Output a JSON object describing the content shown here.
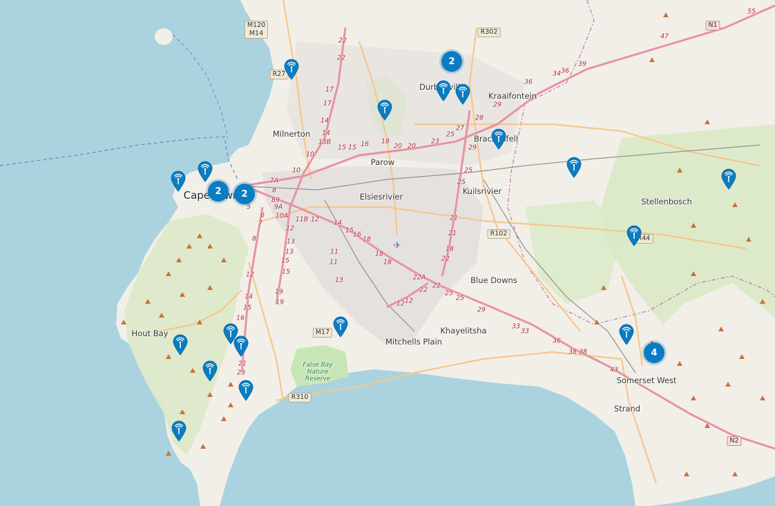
{
  "places": [
    {
      "id": "cape-town",
      "text": "Cape Town",
      "big": true
    },
    {
      "id": "milnerton",
      "text": "Milnerton"
    },
    {
      "id": "parow",
      "text": "Parow"
    },
    {
      "id": "elsiesrivier",
      "text": "Elsiesrivier"
    },
    {
      "id": "kuilsrivier",
      "text": "Kuilsrivier"
    },
    {
      "id": "durbanville",
      "text": "Durbanville"
    },
    {
      "id": "kraaifontein",
      "text": "Kraaifontein"
    },
    {
      "id": "brackenfell",
      "text": "Brackenfell"
    },
    {
      "id": "stellenbosch",
      "text": "Stellenbosch"
    },
    {
      "id": "blue-downs",
      "text": "Blue Downs"
    },
    {
      "id": "khayelitsha",
      "text": "Khayelitsha"
    },
    {
      "id": "mitchells-plain",
      "text": "Mitchells Plain"
    },
    {
      "id": "hout-bay",
      "text": "Hout Bay"
    },
    {
      "id": "somerset-west",
      "text": "Somerset West"
    },
    {
      "id": "strand",
      "text": "Strand"
    },
    {
      "id": "false-bay-reserve",
      "text": "False Bay Nature Reserve",
      "park": true
    }
  ],
  "route_shields": [
    {
      "id": "m120-m14",
      "text": "M120\nM14"
    },
    {
      "id": "r27",
      "text": "R27"
    },
    {
      "id": "r302",
      "text": "R302"
    },
    {
      "id": "n1",
      "text": "N1",
      "national": true
    },
    {
      "id": "r102",
      "text": "R102"
    },
    {
      "id": "r44",
      "text": "R44"
    },
    {
      "id": "m17",
      "text": "M17"
    },
    {
      "id": "r310",
      "text": "R310"
    },
    {
      "id": "n2",
      "text": "N2",
      "national": true
    }
  ],
  "exit_numbers": [
    "55",
    "47",
    "39",
    "36",
    "34",
    "36",
    "29",
    "28",
    "27",
    "25",
    "29",
    "25",
    "25",
    "23",
    "20",
    "20",
    "18",
    "16",
    "15",
    "15",
    "13B",
    "14",
    "14",
    "17",
    "17",
    "22",
    "22",
    "10",
    "10",
    "7A",
    "8",
    "8",
    "9",
    "9A",
    "10A",
    "11B",
    "12",
    "6",
    "7",
    "5",
    "12",
    "13",
    "13",
    "15",
    "15",
    "14",
    "15",
    "16",
    "18",
    "18",
    "18",
    "21",
    "21",
    "18",
    "22A",
    "22",
    "22",
    "22",
    "25",
    "25",
    "29",
    "33",
    "33",
    "36",
    "38",
    "38",
    "43",
    "11",
    "11",
    "13",
    "12",
    "12",
    "14",
    "15",
    "16",
    "19",
    "19",
    "21",
    "23",
    "8",
    "12"
  ],
  "markers": [
    {
      "id": "marker-1",
      "type": "antenna"
    },
    {
      "id": "marker-2",
      "type": "antenna"
    },
    {
      "id": "marker-3",
      "type": "antenna"
    },
    {
      "id": "marker-4",
      "type": "antenna"
    },
    {
      "id": "marker-5",
      "type": "antenna"
    },
    {
      "id": "marker-6",
      "type": "antenna"
    },
    {
      "id": "marker-7",
      "type": "antenna"
    },
    {
      "id": "marker-8",
      "type": "antenna"
    },
    {
      "id": "marker-9",
      "type": "antenna"
    },
    {
      "id": "marker-10",
      "type": "antenna"
    },
    {
      "id": "marker-11",
      "type": "antenna"
    },
    {
      "id": "marker-12",
      "type": "antenna"
    },
    {
      "id": "marker-13",
      "type": "antenna"
    },
    {
      "id": "marker-14",
      "type": "antenna"
    },
    {
      "id": "marker-15",
      "type": "antenna"
    },
    {
      "id": "marker-16",
      "type": "antenna"
    },
    {
      "id": "marker-17",
      "type": "antenna"
    },
    {
      "id": "marker-18",
      "type": "antenna"
    }
  ],
  "clusters": [
    {
      "id": "cluster-durbanville",
      "count": "2"
    },
    {
      "id": "cluster-cape-town-a",
      "count": "2"
    },
    {
      "id": "cluster-cape-town-b",
      "count": "2"
    },
    {
      "id": "cluster-somerset-west",
      "count": "4"
    }
  ],
  "colors": {
    "water": "#aad3df",
    "land": "#f2efe9",
    "park": "#c8e6b5",
    "motorway": "#e892a2",
    "primary": "#f6c68c",
    "marker": "#0b7cc2"
  }
}
